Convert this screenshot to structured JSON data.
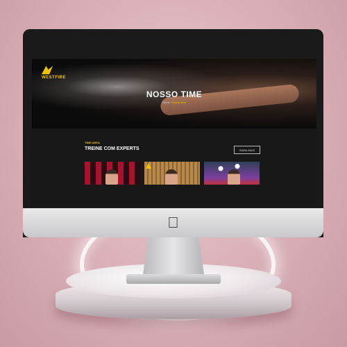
{
  "site": {
    "logo_text": "WESTFIRE",
    "nav": [
      "",
      "",
      "",
      "",
      "",
      "",
      ""
    ],
    "hero_title": "NOSSO TIME",
    "breadcrumb": {
      "home": "Home",
      "separator": "/",
      "current": "Nosso time"
    },
    "section": {
      "tag": "TIME AREA",
      "title": "TREINE COM EXPERTS",
      "button": "SAIBA MAIS"
    }
  },
  "colors": {
    "accent": "#f2c200",
    "background": "#181818"
  },
  "icons": [
    "apple-logo-icon",
    "brand-logo-icon"
  ]
}
